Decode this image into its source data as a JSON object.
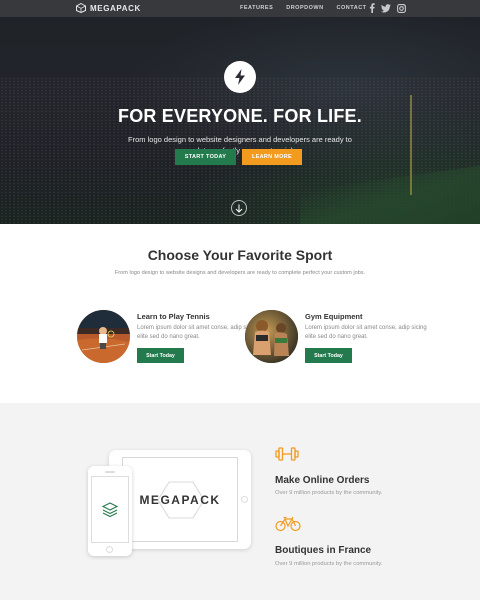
{
  "nav": {
    "brand": "MEGAPACK",
    "links": [
      "FEATURES",
      "DROPDOWN",
      "CONTACT"
    ],
    "social_icons": [
      "facebook-icon",
      "twitter-icon",
      "instagram-icon"
    ]
  },
  "hero": {
    "icon": "lightning-bolt-icon",
    "title": "FOR EVERYONE. FOR LIFE.",
    "subtitle": "From logo design to website designers and developers are ready to complete perfectly your custom jobs.",
    "primary_button": "START TODAY",
    "secondary_button": "LEARN MORE",
    "scroll_icon": "arrow-down-circle-icon"
  },
  "sports": {
    "title": "Choose Your Favorite Sport",
    "subtitle": "From logo design to website designs and developers are ready to complete perfect your custom jobs.",
    "cards": [
      {
        "title": "Learn to Play Tennis",
        "text": "Lorem ipsum dolor sit amet conse, adip sicing elite sed do nano great.",
        "button": "Start Today"
      },
      {
        "title": "Gym Equipment",
        "text": "Lorem ipsum dolor sit amet conse, adip sicing elite sed do nano great.",
        "button": "Start Today"
      }
    ]
  },
  "features": {
    "device_logo": "MEGAPACK",
    "items": [
      {
        "icon": "dumbbell-icon",
        "title": "Make Online Orders",
        "text": "Over 9 million products by the community."
      },
      {
        "icon": "bicycle-icon",
        "title": "Boutiques in France",
        "text": "Over 9 million products by the community."
      }
    ]
  },
  "colors": {
    "accent_green": "#237a4d",
    "accent_orange": "#f29b1f",
    "icon_orange": "#f29b1f"
  }
}
